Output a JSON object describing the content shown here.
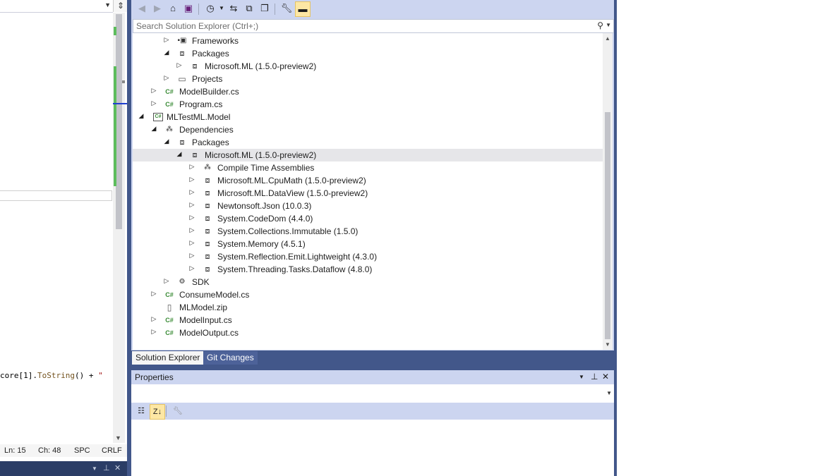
{
  "editor": {
    "code_prefix": "core[1].",
    "code_method": "ToString",
    "code_middle": "() + ",
    "code_string": "\"",
    "status": {
      "ln": "Ln: 15",
      "ch": "Ch: 48",
      "spc": "SPC",
      "crlf": "CRLF"
    }
  },
  "solution_explorer": {
    "search_placeholder": "Search Solution Explorer (Ctrl+;)",
    "tree": [
      {
        "label": "Frameworks"
      },
      {
        "label": "Packages"
      },
      {
        "label": "Microsoft.ML (1.5.0-preview2)"
      },
      {
        "label": "Projects"
      },
      {
        "label": "ModelBuilder.cs"
      },
      {
        "label": "Program.cs"
      },
      {
        "label": "MLTestML.Model"
      },
      {
        "label": "Dependencies"
      },
      {
        "label": "Packages"
      },
      {
        "label": "Microsoft.ML (1.5.0-preview2)"
      },
      {
        "label": "Compile Time Assemblies"
      },
      {
        "label": "Microsoft.ML.CpuMath (1.5.0-preview2)"
      },
      {
        "label": "Microsoft.ML.DataView (1.5.0-preview2)"
      },
      {
        "label": "Newtonsoft.Json (10.0.3)"
      },
      {
        "label": "System.CodeDom (4.4.0)"
      },
      {
        "label": "System.Collections.Immutable (1.5.0)"
      },
      {
        "label": "System.Memory (4.5.1)"
      },
      {
        "label": "System.Reflection.Emit.Lightweight (4.3.0)"
      },
      {
        "label": "System.Threading.Tasks.Dataflow (4.8.0)"
      },
      {
        "label": "SDK"
      },
      {
        "label": "ConsumeModel.cs"
      },
      {
        "label": "MLModel.zip"
      },
      {
        "label": "ModelInput.cs"
      },
      {
        "label": "ModelOutput.cs"
      }
    ],
    "tabs": [
      "Solution Explorer",
      "Git Changes"
    ]
  },
  "properties": {
    "title": "Properties"
  },
  "colors": {
    "accent": "#42578a",
    "tool_window_bg": "#ccd5f0",
    "selection": "#e6e6e9",
    "active_button": "#fde7a4"
  }
}
